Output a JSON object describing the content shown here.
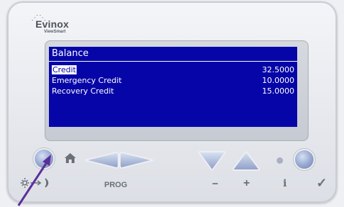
{
  "brand": {
    "name": "Evinox",
    "subname": "ViewSmart"
  },
  "screen": {
    "title": "Balance",
    "rows": [
      {
        "label": "Credit",
        "value": "32.5000",
        "selected": true
      },
      {
        "label": "Emergency Credit",
        "value": "10.0000",
        "selected": false
      },
      {
        "label": "Recovery Credit",
        "value": "15.0000",
        "selected": false
      }
    ]
  },
  "buttons": {
    "prog_label": "PROG",
    "minus_label": "−",
    "plus_label": "+",
    "info_label": "i",
    "check_label": "✓"
  },
  "colors": {
    "screen_bg": "#0606a8",
    "screen_text": "#ffffff",
    "button_blue": "#9fb0d6"
  }
}
